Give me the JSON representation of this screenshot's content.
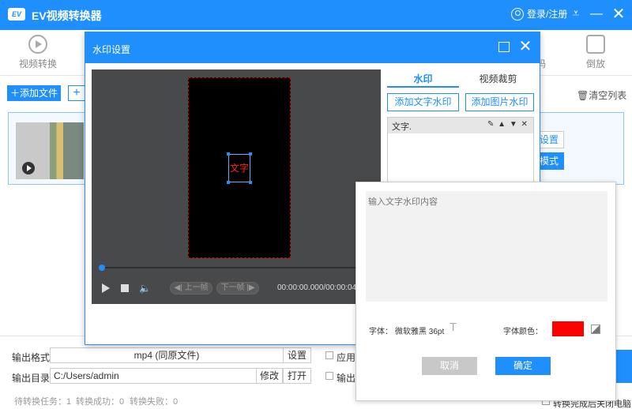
{
  "app": {
    "logo_text": "EV",
    "title": "EV视频转换器",
    "login_label": "登录/注册"
  },
  "toolbar": {
    "convert_label": "视频转换",
    "code_label": "码",
    "reverse_label": "倒放"
  },
  "main": {
    "add_file_label": "添加文件",
    "add_more_label": "+",
    "clear_list_label": "清空列表",
    "right_settings_label": "设置",
    "right_mode_label": "模式"
  },
  "bottom": {
    "output_format_label": "输出格式",
    "output_format_value": "mp4 (同原文件)",
    "format_settings_label": "设置",
    "apply_label": "应用到",
    "output_dir_label": "输出目录",
    "output_dir_value": "C:/Users/admin",
    "modify_label": "修改",
    "open_label": "打开",
    "output_to_label": "输出到",
    "status_pending": "待转换任务：1",
    "status_success": "转换成功：0",
    "status_failed": "转换失败：0",
    "shutdown_label": "转换完成后关闭电脑"
  },
  "dialog": {
    "title": "水印设置",
    "watermark_text": "文字",
    "prev_frame": "◀| 上一帧",
    "next_frame": "下一帧 |▶",
    "timecode": "00:00:00.000/00:00:04",
    "tab_watermark": "水印",
    "tab_crop": "视频裁剪",
    "add_text_wm": "添加文字水印",
    "add_image_wm": "添加图片水印",
    "wm_item_name": "文字.",
    "wm_item_ops": "✎ ▲ ▼ ✕"
  },
  "text_panel": {
    "placeholder": "输入文字水印内容",
    "font_label": "字体：",
    "font_value": "微软雅黑 36pt",
    "font_icon": "T",
    "color_label": "字体颜色：",
    "color_value": "#ff0000",
    "cancel_label": "取消",
    "ok_label": "确定"
  }
}
